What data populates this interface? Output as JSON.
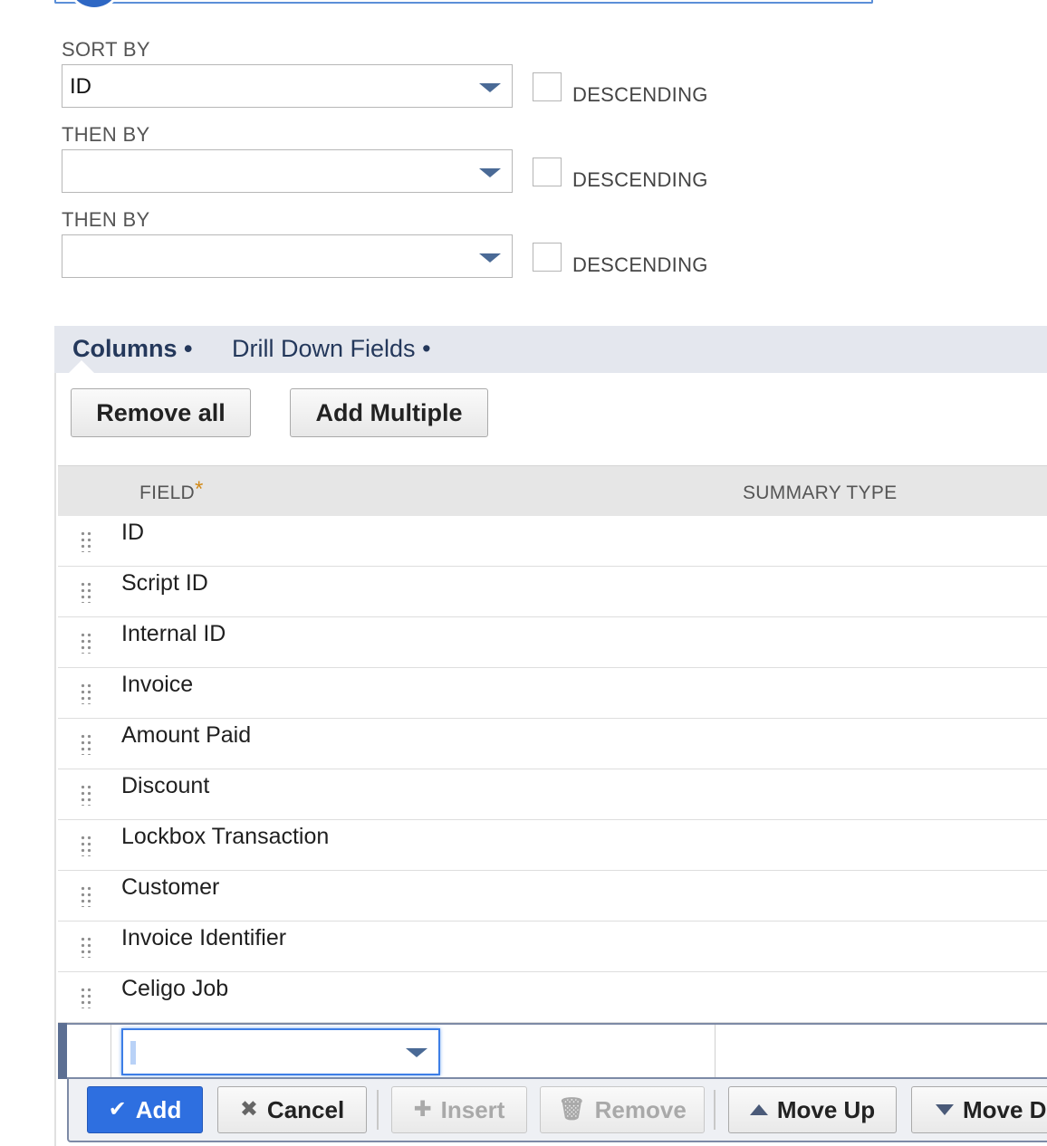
{
  "sort": {
    "sort_by_label": "SORT BY",
    "sort_by_value": "ID",
    "then_by_label": "THEN BY",
    "then_by_1_value": "",
    "then_by_2_value": "",
    "descending_label": "DESCENDING",
    "descending_checked": [
      false,
      false,
      false
    ]
  },
  "tabs": [
    {
      "label": "Columns",
      "active": true,
      "marker": "•"
    },
    {
      "label": "Drill Down Fields",
      "active": false,
      "marker": "•"
    }
  ],
  "toolbar": {
    "remove_all_label": "Remove all",
    "add_multiple_label": "Add Multiple"
  },
  "grid": {
    "headers": {
      "field": "FIELD",
      "required_marker": "*",
      "summary_type": "SUMMARY TYPE"
    },
    "rows": [
      {
        "field": "ID"
      },
      {
        "field": "Script ID"
      },
      {
        "field": "Internal ID"
      },
      {
        "field": "Invoice"
      },
      {
        "field": "Amount Paid"
      },
      {
        "field": "Discount"
      },
      {
        "field": "Lockbox Transaction"
      },
      {
        "field": "Customer"
      },
      {
        "field": "Invoice Identifier"
      },
      {
        "field": "Celigo Job"
      }
    ],
    "edit_row_value": ""
  },
  "actions": {
    "add_label": "Add",
    "cancel_label": "Cancel",
    "insert_label": "Insert",
    "remove_label": "Remove",
    "move_up_label": "Move Up",
    "move_down_label": "Move Down",
    "icons": {
      "add": "checkmark-icon",
      "cancel": "x-icon",
      "insert": "plus-icon",
      "remove": "trash-icon",
      "move_up": "triangle-up-icon",
      "move_down": "triangle-down-icon"
    }
  },
  "colors": {
    "primary": "#2e6fe0",
    "tab_text": "#24385b",
    "required": "#d28a1a"
  }
}
